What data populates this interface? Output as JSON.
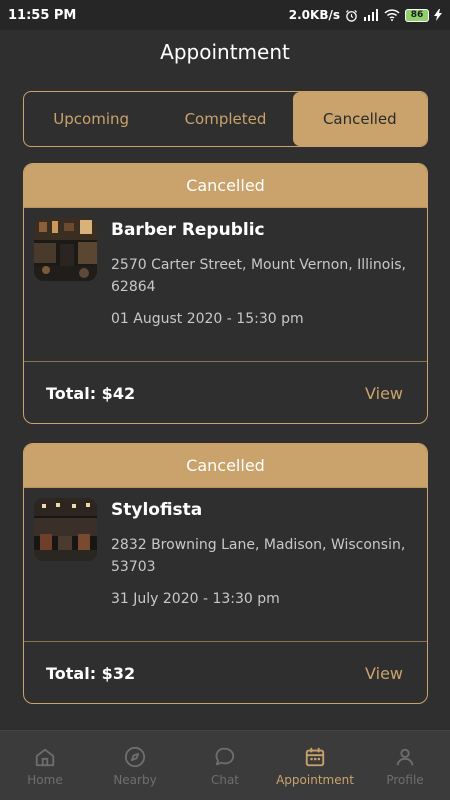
{
  "status_bar": {
    "time": "11:55 PM",
    "speed": "2.0KB/s",
    "battery": "86",
    "icons": [
      "alarm-icon",
      "signal-icon",
      "wifi-icon",
      "charging-icon"
    ]
  },
  "header": {
    "title": "Appointment"
  },
  "tabs": [
    {
      "label": "Upcoming",
      "active": false
    },
    {
      "label": "Completed",
      "active": false
    },
    {
      "label": "Cancelled",
      "active": true
    }
  ],
  "appointments": [
    {
      "status": "Cancelled",
      "name": "Barber Republic",
      "address": "2570 Carter Street, Mount Vernon, Illinois, 62864",
      "date": "01 August 2020 - 15:30 pm",
      "total": "Total: $42",
      "action": "View"
    },
    {
      "status": "Cancelled",
      "name": "Stylofista",
      "address": "2832 Browning Lane, Madison, Wisconsin, 53703",
      "date": "31 July 2020 - 13:30 pm",
      "total": "Total: $32",
      "action": "View"
    }
  ],
  "bottom_nav": [
    {
      "label": "Home",
      "icon": "home-icon",
      "active": false
    },
    {
      "label": "Nearby",
      "icon": "compass-icon",
      "active": false
    },
    {
      "label": "Chat",
      "icon": "chat-icon",
      "active": false
    },
    {
      "label": "Appointment",
      "icon": "calendar-icon",
      "active": true
    },
    {
      "label": "Profile",
      "icon": "profile-icon",
      "active": false
    }
  ],
  "colors": {
    "accent": "#c9a36b",
    "background": "#2f2f2f",
    "nav_background": "#3b3b3b",
    "inactive": "#6e6e6e"
  }
}
